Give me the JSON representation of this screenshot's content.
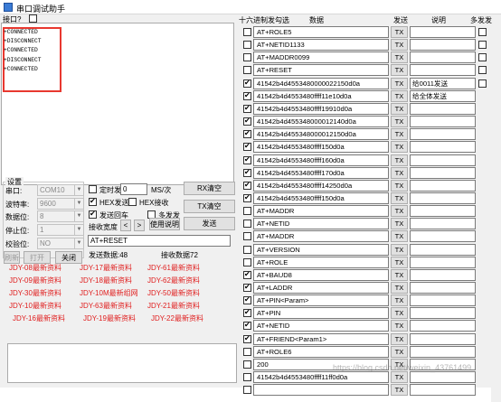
{
  "window": {
    "title": "串口调试助手"
  },
  "recv": {
    "hint_label": "接口?",
    "lines": [
      "+CONNECTED",
      "+DISCONNECT",
      "+CONNECTED",
      "+DISCONNECT",
      "+CONNECTED"
    ]
  },
  "settings": {
    "group_title": "设置",
    "port_label": "串口:",
    "port_value": "COM10",
    "baud_label": "波特率:",
    "baud_value": "9600",
    "databits_label": "数据位:",
    "databits_value": "8",
    "stopbits_label": "停止位:",
    "stopbits_value": "1",
    "parity_label": "校验位:",
    "parity_value": "NO",
    "refresh_label": "刷新",
    "open_label": "打开",
    "close_label": "关闭"
  },
  "options": {
    "timed_send_label": "定时发",
    "timed_send_value": "0",
    "timed_unit": "MS/次",
    "hex_send_label": "HEX发送",
    "hex_recv_label": "HEX接收",
    "echo_label": "发送回车",
    "multi_label": "多发发",
    "recv_width_label": "接收宽度",
    "prev_label": "<",
    "next_label": ">",
    "usage_label": "使用说明",
    "rx_clear_label": "RX清空",
    "tx_clear_label": "TX清空",
    "send_label": "发送",
    "send_input_value": "AT+RESET",
    "sent_count_label": "发送数据:48",
    "recv_count_label": "接收数据72"
  },
  "macros": [
    "JDY-08最新资料",
    "JDY-17最新资料",
    "JDY-61最新资料",
    "JDY-09最新资料",
    "JDY-18最新资料",
    "JDY-62最新资料",
    "JDY-30最新资料",
    "JDY-10M最新组网",
    "JDY-50最新资料",
    "JDY-10最新资料",
    "JDY-63最新资料",
    "JDY-21最新资料",
    "JDY-16最新资料",
    "JDY-19最新资料",
    "JDY-22最新资料"
  ],
  "right_panel": {
    "col_hex": "十六进制发勾选",
    "col_data": "数据",
    "col_send": "发送",
    "col_note": "说明",
    "col_multi": "多发发",
    "tx_label": "TX",
    "rows": [
      {
        "checked": false,
        "data": "AT+ROLE5",
        "note": "",
        "multi": true
      },
      {
        "checked": false,
        "data": "AT+NETID1133",
        "note": "",
        "multi": true
      },
      {
        "checked": false,
        "data": "AT+MADDR0099",
        "note": "",
        "multi": true
      },
      {
        "checked": false,
        "data": "AT+RESET",
        "note": "",
        "multi": true
      },
      {
        "checked": true,
        "data": "41542b4d4553480000022150d0a",
        "note": "给0011发送",
        "multi": true
      },
      {
        "checked": true,
        "data": "41542b4d4553480ffff11e10d0a",
        "note": "给全体发送",
        "multi": false
      },
      {
        "checked": true,
        "data": "41542b4d4553480ffff19910d0a",
        "note": "",
        "multi": false
      },
      {
        "checked": true,
        "data": "41542b4d455348000012140d0a",
        "note": "",
        "multi": false
      },
      {
        "checked": true,
        "data": "41542b4d455348000012150d0a",
        "note": "",
        "multi": false
      },
      {
        "checked": true,
        "data": "41542b4d4553480ffff150d0a",
        "note": "",
        "multi": false
      },
      {
        "checked": true,
        "data": "41542b4d4553480ffff160d0a",
        "note": "",
        "multi": false
      },
      {
        "checked": true,
        "data": "41542b4d4553480ffff170d0a",
        "note": "",
        "multi": false
      },
      {
        "checked": true,
        "data": "41542b4d4553480ffff14250d0a",
        "note": "",
        "multi": false
      },
      {
        "checked": true,
        "data": "41542b4d4553480ffff150d0a",
        "note": "",
        "multi": false
      },
      {
        "checked": false,
        "data": "AT+MADDR",
        "note": "",
        "multi": false
      },
      {
        "checked": false,
        "data": "AT+NETID",
        "note": "",
        "multi": false
      },
      {
        "checked": false,
        "data": "AT+MADDR",
        "note": "",
        "multi": false
      },
      {
        "checked": false,
        "data": "AT+VERSION",
        "note": "",
        "multi": false
      },
      {
        "checked": false,
        "data": "AT+ROLE",
        "note": "",
        "multi": false
      },
      {
        "checked": true,
        "data": "AT+BAUD8",
        "note": "",
        "multi": false
      },
      {
        "checked": true,
        "data": "AT+LADDR",
        "note": "",
        "multi": false
      },
      {
        "checked": true,
        "data": "AT+PIN<Param>",
        "note": "",
        "multi": false
      },
      {
        "checked": true,
        "data": "AT+PIN",
        "note": "",
        "multi": false
      },
      {
        "checked": true,
        "data": "AT+NETID",
        "note": "",
        "multi": false
      },
      {
        "checked": true,
        "data": "AT+FRIEND<Param1>",
        "note": "",
        "multi": false
      },
      {
        "checked": false,
        "data": "AT+ROLE6",
        "note": "",
        "multi": false
      },
      {
        "checked": false,
        "data": "200",
        "note": "",
        "multi": false
      },
      {
        "checked": false,
        "data": "41542b4d4553480ffff11ff0d0a",
        "note": "",
        "multi": false
      },
      {
        "checked": false,
        "data": "",
        "note": "",
        "multi": false
      }
    ]
  },
  "watermark": "https://blog.csdn.net/weixin_43761499"
}
